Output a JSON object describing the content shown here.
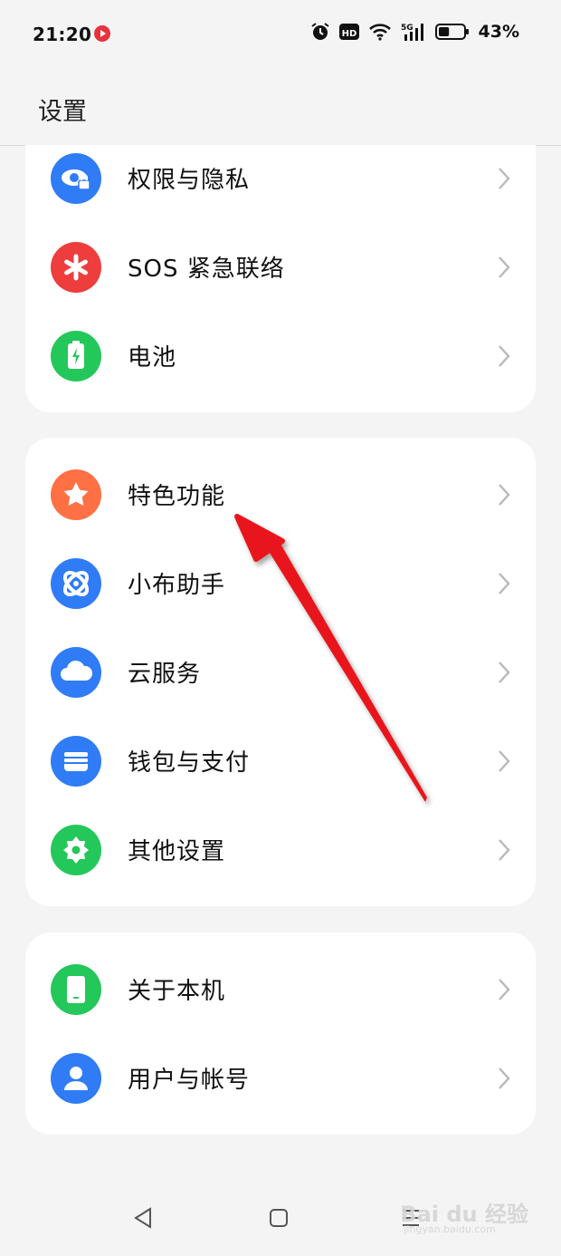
{
  "status_bar": {
    "time": "21:20",
    "battery_percent": "43%",
    "battery_level": 0.43,
    "icons": [
      "recording-icon",
      "alarm-icon",
      "hd-icon",
      "wifi-icon",
      "signal-5g-icon",
      "battery-icon"
    ],
    "network_label": "5G",
    "hd_label": "HD"
  },
  "header": {
    "title": "设置"
  },
  "groups": [
    {
      "items": [
        {
          "label": "权限与隐私",
          "icon": "privacy-eye-lock-icon",
          "color": "#2f7cf6"
        },
        {
          "label": "SOS 紧急联络",
          "icon": "sos-asterisk-icon",
          "color": "#ee3d3d"
        },
        {
          "label": "电池",
          "icon": "battery-charge-icon",
          "color": "#23c75a"
        }
      ]
    },
    {
      "items": [
        {
          "label": "特色功能",
          "icon": "star-icon",
          "color": "#ff7044"
        },
        {
          "label": "小布助手",
          "icon": "assistant-orbit-icon",
          "color": "#2f7cf6"
        },
        {
          "label": "云服务",
          "icon": "cloud-icon",
          "color": "#2f7cf6"
        },
        {
          "label": "钱包与支付",
          "icon": "wallet-icon",
          "color": "#2f7cf6"
        },
        {
          "label": "其他设置",
          "icon": "gear-icon",
          "color": "#23c75a"
        }
      ]
    },
    {
      "items": [
        {
          "label": "关于本机",
          "icon": "phone-icon",
          "color": "#23c75a"
        },
        {
          "label": "用户与帐号",
          "icon": "user-icon",
          "color": "#2f7cf6"
        }
      ]
    }
  ],
  "nav": {
    "buttons": [
      "back-icon",
      "home-icon",
      "menu-icon"
    ]
  },
  "annotation": {
    "arrow_color": "#e8141b"
  },
  "watermark": {
    "text": "Bai du 经验",
    "sub": "jingyan.baidu.com"
  }
}
